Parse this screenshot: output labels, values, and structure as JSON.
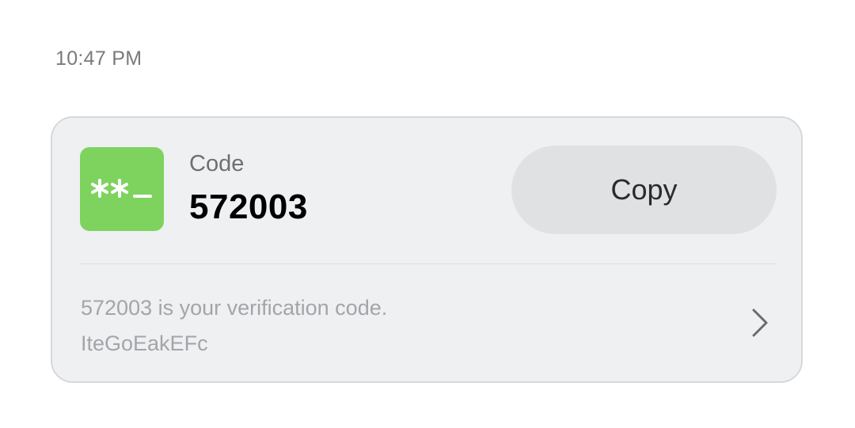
{
  "status": {
    "time": "10:47 PM"
  },
  "card": {
    "icon": "password-code-icon",
    "icon_color": "#7ed35f",
    "label": "Code",
    "code": "572003",
    "copy_label": "Copy",
    "message_line1": "572003 is your verification code.",
    "message_line2": "IteGoEakEFc",
    "expand_icon": "chevron-right-icon"
  }
}
